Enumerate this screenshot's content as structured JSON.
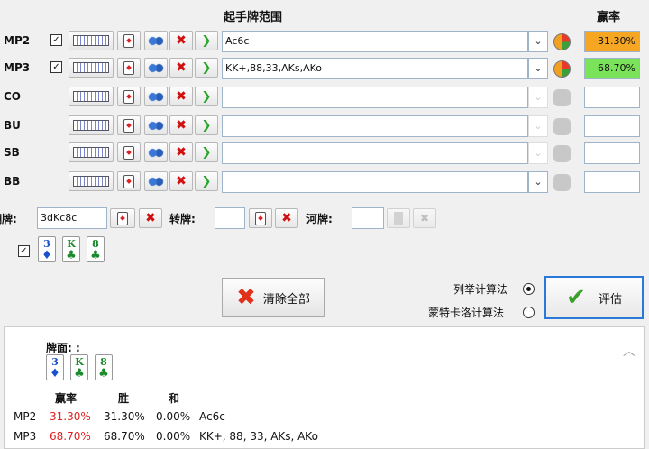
{
  "headers": {
    "range": "起手牌范围",
    "equity": "赢率"
  },
  "players": [
    {
      "label": "MP2",
      "checked": true,
      "range": "Ac6c",
      "equity": "31.30%",
      "equity_color": "#f5a623",
      "active": true
    },
    {
      "label": "MP3",
      "checked": true,
      "range": "KK+,88,33,AKs,AKo",
      "equity": "68.70%",
      "equity_color": "#7be35a",
      "active": true
    },
    {
      "label": "CO",
      "checked": false,
      "range": "",
      "equity": "",
      "active": false
    },
    {
      "label": "BU",
      "checked": false,
      "range": "",
      "equity": "",
      "active": false
    },
    {
      "label": "SB",
      "checked": false,
      "range": "",
      "equity": "",
      "active": false
    },
    {
      "label": "BB",
      "checked": false,
      "range": "",
      "equity": "",
      "active": false
    }
  ],
  "board": {
    "flop_label": "翻牌:",
    "flop_value": "3dKc8c",
    "turn_label": "转牌:",
    "river_label": "河牌:",
    "checked": true,
    "cards": [
      {
        "rank": "3",
        "suit": "♦",
        "color": "#1a4fd0"
      },
      {
        "rank": "K",
        "suit": "♣",
        "color": "#1a8a2a"
      },
      {
        "rank": "8",
        "suit": "♣",
        "color": "#1a8a2a"
      }
    ]
  },
  "actions": {
    "clear_all": "清除全部",
    "enumerate": "列举计算法",
    "monte_carlo": "蒙特卡洛计算法",
    "evaluate": "评估"
  },
  "results": {
    "board_title": "牌面: :",
    "col_equity": "赢率",
    "col_win": "胜",
    "col_tie": "和",
    "rows": [
      {
        "player": "MP2",
        "equity": "31.30%",
        "win": "31.30%",
        "tie": "0.00%",
        "hand": "Ac6c"
      },
      {
        "player": "MP3",
        "equity": "68.70%",
        "win": "68.70%",
        "tie": "0.00%",
        "hand": "KK+, 88, 33, AKs, AKo"
      }
    ]
  }
}
